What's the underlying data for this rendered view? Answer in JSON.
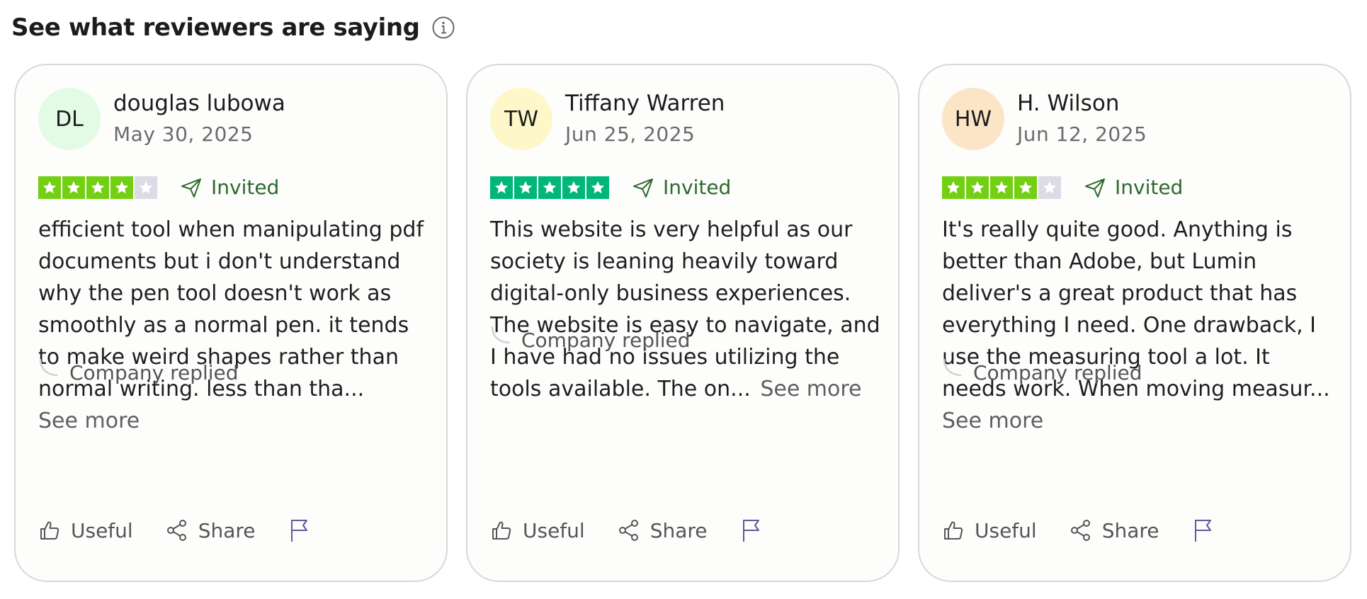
{
  "header": {
    "title": "See what reviewers are saying",
    "info_icon": "info-icon"
  },
  "colors": {
    "star_green_partial": "#73cf11",
    "star_green_full": "#00b67a",
    "star_empty": "#dcdce6",
    "invited_text": "#2d6a2c",
    "flag_icon": "#5b5b9a"
  },
  "reviews": [
    {
      "initials": "DL",
      "avatar_color": "#e3fbe5",
      "name": "douglas lubowa",
      "date": "May 30, 2025",
      "rating": 4,
      "rating_max": 5,
      "invited_label": "Invited",
      "text": "efficient tool when manipulating pdf documents but i don't understand why the pen tool doesn't work as smoothly as a normal pen. it tends to make weird shapes rather than normal writing. less than tha...",
      "see_more": "See more",
      "see_more_inline": false,
      "company_replied": "Company replied",
      "useful_label": "Useful",
      "share_label": "Share"
    },
    {
      "initials": "TW",
      "avatar_color": "#fef7c9",
      "name": "Tiffany Warren",
      "date": "Jun 25, 2025",
      "rating": 5,
      "rating_max": 5,
      "invited_label": "Invited",
      "text": "This website is very helpful as our society is leaning heavily toward digital-only business experiences. The website is easy to navigate, and I have had no issues utilizing the tools available. The on...",
      "see_more": "See more",
      "see_more_inline": true,
      "company_replied": "Company replied",
      "useful_label": "Useful",
      "share_label": "Share"
    },
    {
      "initials": "HW",
      "avatar_color": "#fbe5c6",
      "name": "H. Wilson",
      "date": "Jun 12, 2025",
      "rating": 4,
      "rating_max": 5,
      "invited_label": "Invited",
      "text": "It's really quite good. Anything is better than Adobe, but Lumin deliver's a great product that has everything I need. One drawback, I use the measuring tool a lot. It needs work. When moving measur...",
      "see_more": "See more",
      "see_more_inline": false,
      "company_replied": "Company replied",
      "useful_label": "Useful",
      "share_label": "Share"
    }
  ]
}
